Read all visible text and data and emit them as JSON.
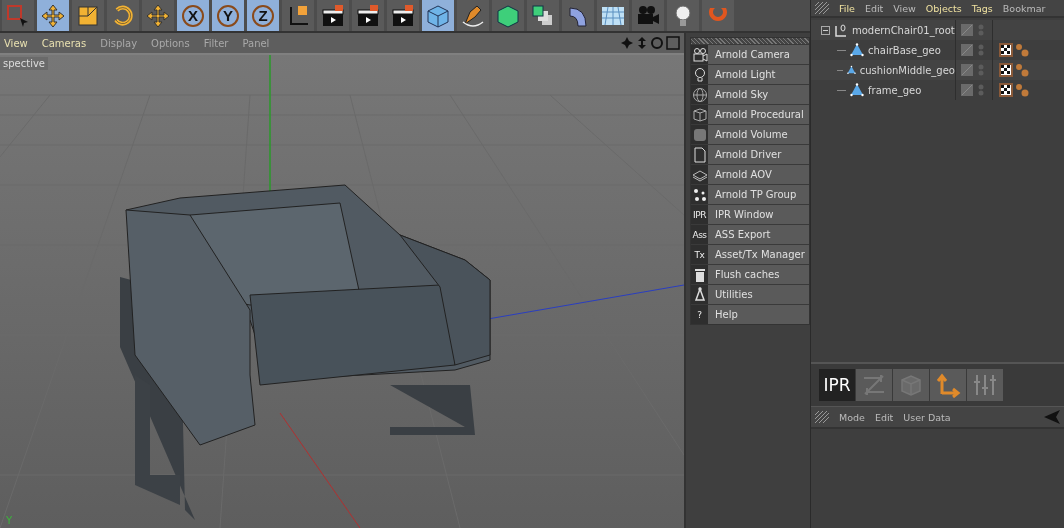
{
  "toolbar": [
    {
      "kind": "select",
      "selected": false
    },
    {
      "kind": "move",
      "selected": true
    },
    {
      "kind": "scale",
      "selected": false
    },
    {
      "kind": "rotate",
      "selected": false
    },
    {
      "kind": "move",
      "selected": false
    },
    {
      "kind": "axis",
      "label": "X",
      "selected": true
    },
    {
      "kind": "axis",
      "label": "Y",
      "selected": true
    },
    {
      "kind": "axis",
      "label": "Z",
      "selected": true
    },
    {
      "kind": "coords",
      "selected": false
    },
    {
      "kind": "render",
      "selected": false
    },
    {
      "kind": "render",
      "selected": false
    },
    {
      "kind": "render",
      "selected": false
    },
    {
      "kind": "cube",
      "selected": true
    },
    {
      "kind": "pen",
      "selected": false
    },
    {
      "kind": "subdiv",
      "selected": false
    },
    {
      "kind": "array",
      "selected": false
    },
    {
      "kind": "bend",
      "selected": false
    },
    {
      "kind": "floor",
      "selected": false
    },
    {
      "kind": "camera",
      "selected": false
    },
    {
      "kind": "light",
      "selected": false
    },
    {
      "kind": "deformer",
      "selected": false
    }
  ],
  "viewport": {
    "menu": [
      {
        "label": "View",
        "dimmed": false
      },
      {
        "label": "Cameras",
        "dimmed": false
      },
      {
        "label": "Display",
        "dimmed": true
      },
      {
        "label": "Options",
        "dimmed": true
      },
      {
        "label": "Filter",
        "dimmed": true
      },
      {
        "label": "Panel",
        "dimmed": true
      }
    ],
    "view_name": "spective",
    "axis_label": "Y"
  },
  "arnold_menu": [
    {
      "kind": "camera",
      "label": "Arnold Camera"
    },
    {
      "kind": "light",
      "label": "Arnold Light"
    },
    {
      "kind": "sky",
      "label": "Arnold Sky"
    },
    {
      "kind": "procedural",
      "label": "Arnold Procedural"
    },
    {
      "kind": "volume",
      "label": "Arnold Volume"
    },
    {
      "kind": "driver",
      "label": "Arnold Driver"
    },
    {
      "kind": "aov",
      "label": "Arnold AOV"
    },
    {
      "kind": "tpgroup",
      "label": "Arnold TP Group"
    },
    {
      "kind": "text",
      "icon_text": "IPR",
      "label": "IPR Window"
    },
    {
      "kind": "text",
      "icon_text": "Ass",
      "label": "ASS Export"
    },
    {
      "kind": "text",
      "icon_text": "Tx",
      "label": "Asset/Tx Manager"
    },
    {
      "kind": "trash",
      "label": "Flush caches"
    },
    {
      "kind": "utilities",
      "label": "Utilities"
    },
    {
      "kind": "text",
      "icon_text": "?",
      "label": "Help"
    }
  ],
  "object_manager": {
    "menu": [
      {
        "label": "File",
        "dimmed": false
      },
      {
        "label": "Edit",
        "dimmed": true
      },
      {
        "label": "View",
        "dimmed": true
      },
      {
        "label": "Objects",
        "dimmed": false
      },
      {
        "label": "Tags",
        "dimmed": false
      },
      {
        "label": "Bookmar",
        "dimmed": true
      }
    ],
    "tree": [
      {
        "name": "modernChair01_root",
        "kind": "null",
        "expanded": true,
        "children": [
          {
            "name": "chairBase_geo",
            "kind": "mesh"
          },
          {
            "name": "cushionMiddle_geo",
            "kind": "mesh"
          },
          {
            "name": "frame_geo",
            "kind": "mesh"
          }
        ]
      }
    ]
  },
  "ipr_toolbar": [
    {
      "kind": "text",
      "label": "IPR",
      "selected": true
    },
    {
      "kind": "shuffle",
      "selected": false
    },
    {
      "kind": "box",
      "selected": false
    },
    {
      "kind": "axis",
      "selected": false
    },
    {
      "kind": "sliders",
      "selected": false
    }
  ],
  "attribute_manager": {
    "menu": [
      "Mode",
      "Edit",
      "User Data"
    ]
  }
}
